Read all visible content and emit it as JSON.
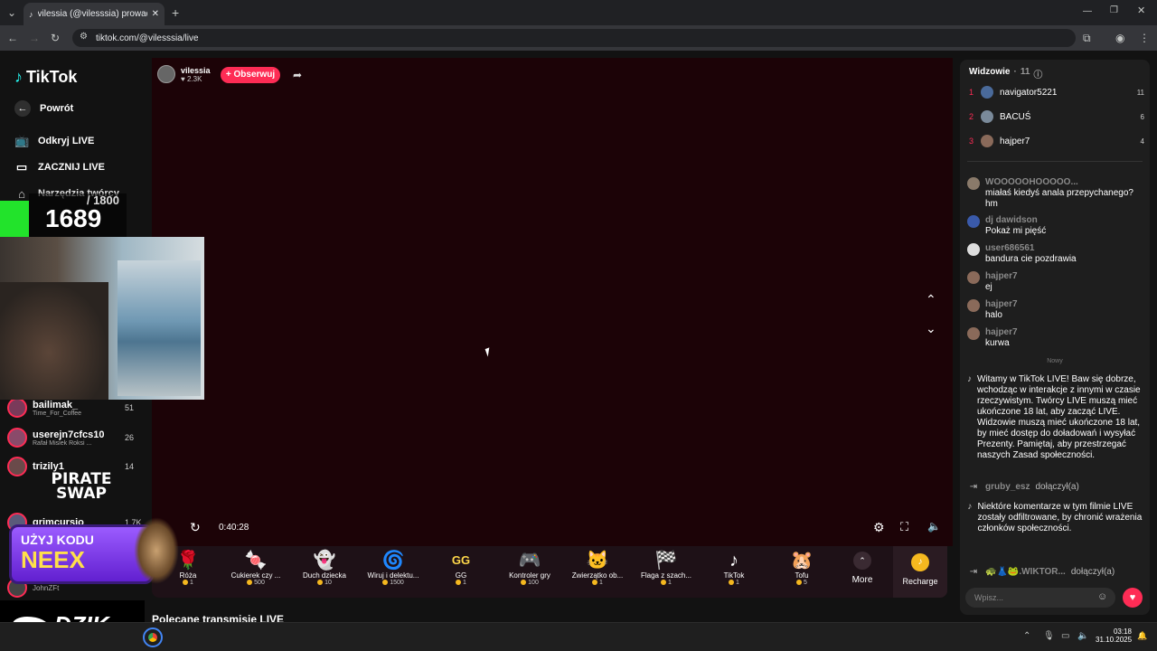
{
  "browser": {
    "tab_title": "vilessia (@vilesssia) prowadzi…",
    "url": "tiktok.com/@vilesssia/live",
    "new_tab_icon": "plus-icon"
  },
  "sidebar": {
    "logo": "TikTok",
    "back": "Powrót",
    "items": [
      {
        "label": "Odkryj LIVE",
        "icon": "tv-icon"
      },
      {
        "label": "ZACZNIJ LIVE",
        "icon": "camera-icon"
      },
      {
        "label": "Narzędzia twórcy",
        "icon": "home-icon"
      }
    ],
    "live_users": [
      {
        "name": "bailimak_",
        "sub": "Time_For_Coffee",
        "count": "51"
      },
      {
        "name": "userejn7cfcs10",
        "sub": "Rafał Misiek Roksi ...",
        "count": "26"
      },
      {
        "name": "trizily1",
        "sub": "",
        "count": "14"
      },
      {
        "name": "grimcursio",
        "sub": "",
        "count": "1.7K"
      },
      {
        "name": "JohnZFt",
        "sub": "",
        "count": ""
      }
    ]
  },
  "stream": {
    "host_name": "vilessia",
    "host_likes": "2.3K",
    "follow_label": "+ Obserwuj",
    "elapsed": "0:40:28",
    "recommended_heading": "Polecane transmisje LIVE"
  },
  "overlay": {
    "counter_total": "/ 1800",
    "counter_value": "1689",
    "pirate_swap": "PIRATE SWAP",
    "promo_line1": "UŻYJ KODU",
    "promo_line2": "NEEX",
    "dzik": "DZIK."
  },
  "gifts": [
    {
      "name": "Róża",
      "price": "1",
      "emoji": "🌹"
    },
    {
      "name": "Cukierek czy ...",
      "price": "500",
      "emoji": "🍬"
    },
    {
      "name": "Duch dziecka",
      "price": "10",
      "emoji": "👻"
    },
    {
      "name": "Wiruj i delektu...",
      "price": "1500",
      "emoji": "🌀"
    },
    {
      "name": "GG",
      "price": "1",
      "emoji": "GG"
    },
    {
      "name": "Kontroler gry",
      "price": "100",
      "emoji": "🎮"
    },
    {
      "name": "Zwierzątko ob...",
      "price": "1",
      "emoji": "🐱"
    },
    {
      "name": "Flaga z szach...",
      "price": "1",
      "emoji": "🏁"
    },
    {
      "name": "TikTok",
      "price": "1",
      "emoji": "♪"
    },
    {
      "name": "Tofu",
      "price": "5",
      "emoji": "🐹"
    }
  ],
  "gift_more": "More",
  "recharge": "Recharge",
  "viewers": {
    "title": "Widzowie",
    "count": "11",
    "list": [
      {
        "rank": "1",
        "name": "navigator5221",
        "score": "11"
      },
      {
        "rank": "2",
        "name": "BACUŚ",
        "score": "6"
      },
      {
        "rank": "3",
        "name": "hajper7",
        "score": "4"
      }
    ]
  },
  "chat": {
    "messages": [
      {
        "user": "WOOOOOHOOOOO...",
        "text": "miałaś kiedyś anala przepychanego? hm"
      },
      {
        "user": "dj dawidson",
        "text": "Pokaż mi pięść"
      },
      {
        "user": "user686561",
        "text": "bandura cie pozdrawia"
      },
      {
        "user": "hajper7",
        "text": "ej"
      },
      {
        "user": "hajper7",
        "text": "halo"
      },
      {
        "user": "hajper7",
        "text": "kurwa"
      }
    ],
    "new_label": "Nowy",
    "system_welcome": "Witamy w TikTok LIVE! Baw się dobrze, wchodząc w interakcje z innymi w czasie rzeczywistym. Twórcy LIVE muszą mieć ukończone 18 lat, aby zacząć LIVE. Widzowie muszą mieć ukończone 18 lat, by mieć dostęp do doładowań i wysyłać Prezenty. Pamiętaj, aby przestrzegać naszych Zasad społeczności.",
    "joined1_user": "gruby_esz",
    "joined_label": "dołączył(a)",
    "system_filter": "Niektóre komentarze w tym filmie LIVE zostały odfiltrowane, by chronić wrażenia członków społeczności.",
    "joined2_user": "🐢👗🐸.WIKTOR...",
    "input_placeholder": "Wpisz..."
  },
  "taskbar": {
    "time": "03:18",
    "date": "31.10.2025"
  },
  "colors": {
    "accent": "#fe2c55",
    "video_bg": "#1c0307",
    "promo_purple": "#7b2ff7",
    "counter_green": "#22e32b"
  }
}
